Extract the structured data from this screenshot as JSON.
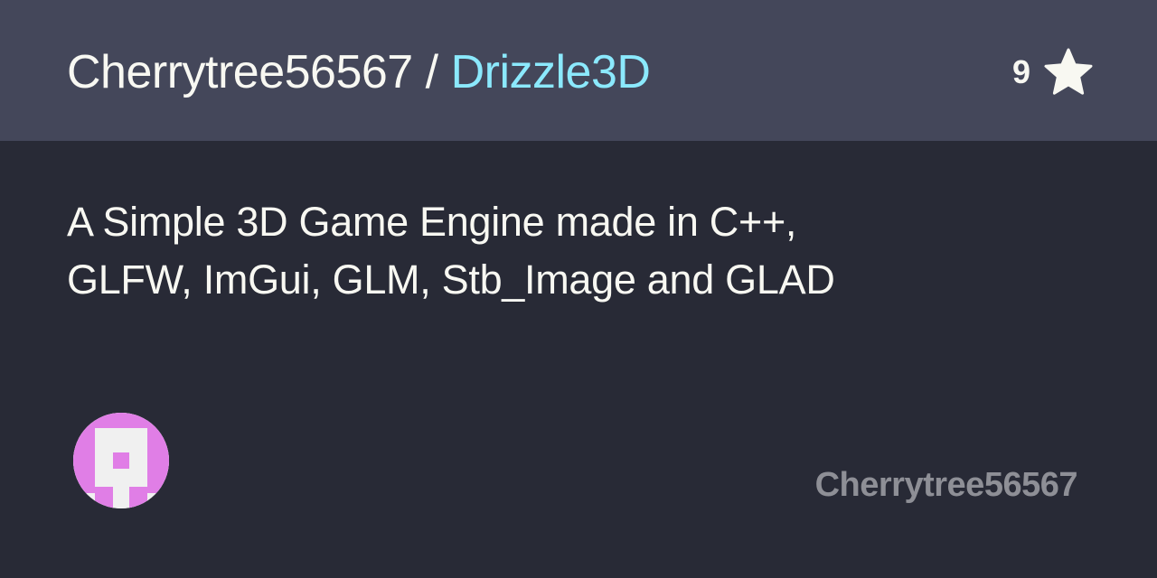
{
  "header": {
    "owner": "Cherrytree56567",
    "separator": " / ",
    "repo": "Drizzle3D",
    "star_count": "9",
    "star_icon": "star-icon"
  },
  "description": {
    "line1": "A Simple 3D Game Engine made in C++,",
    "line2": "GLFW, ImGui, GLM, Stb_Image and GLAD"
  },
  "footer": {
    "owner_label": "Cherrytree56567",
    "avatar_icon": "identicon-avatar"
  },
  "colors": {
    "background": "#282a36",
    "header_background": "#44475a",
    "repo_name": "#8be9fd",
    "text": "#f8f8f2",
    "muted": "#8e8f96",
    "avatar_accent": "#e07ee6",
    "avatar_background": "#f0f0f0"
  }
}
